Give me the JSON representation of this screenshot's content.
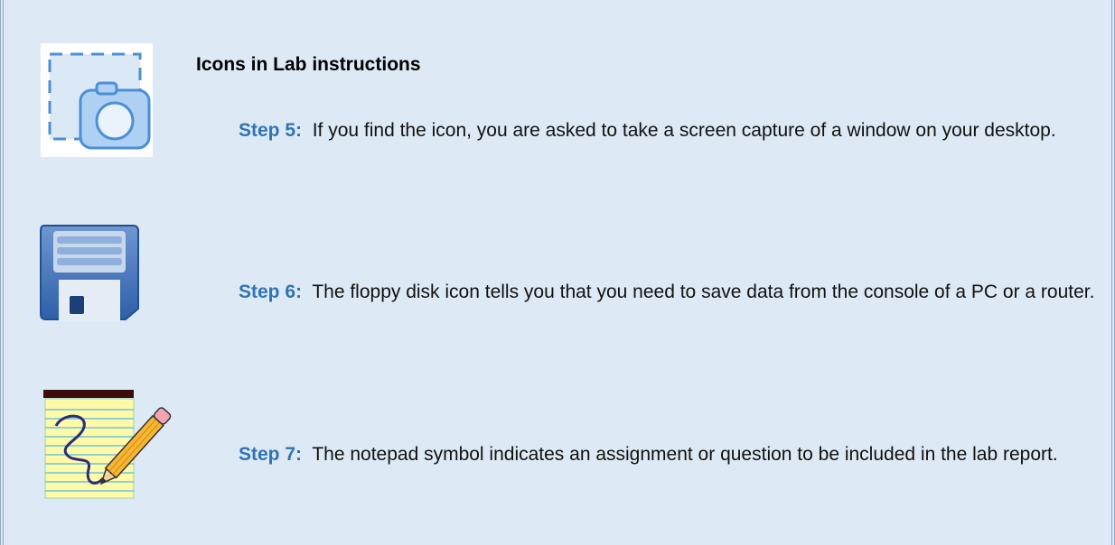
{
  "section": {
    "title": "Icons in Lab instructions"
  },
  "steps": [
    {
      "label": "Step 5:",
      "text": "If you find the icon, you are asked to take a screen capture of a window on your desktop.",
      "icon": "screen-capture-icon"
    },
    {
      "label": "Step 6:",
      "text": "The floppy disk icon tells you that you need to save data from the console of a PC or a router.",
      "icon": "floppy-disk-icon"
    },
    {
      "label": "Step 7:",
      "text": "The notepad symbol indicates an assignment or question to be included in the lab report.",
      "icon": "notepad-pencil-icon"
    }
  ],
  "colors": {
    "panel_bg": "#dde9f4",
    "step_label": "#2f74b5",
    "border": "#8da6c4"
  }
}
